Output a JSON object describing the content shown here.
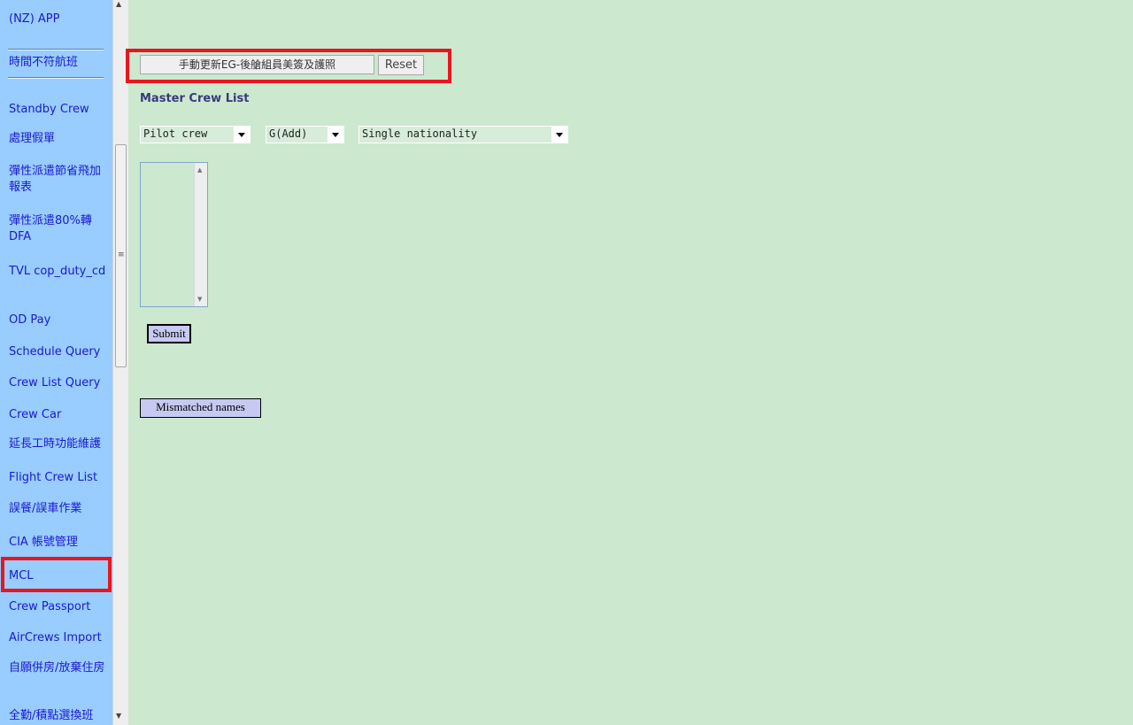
{
  "sidebar": {
    "items": [
      {
        "label": "(NZ) APP"
      },
      {
        "label": "時間不符航班"
      },
      {
        "label": "Standby Crew"
      },
      {
        "label": "處理假單"
      },
      {
        "label": "彈性派遣節省飛加報表"
      },
      {
        "label": "彈性派遣80%轉DFA"
      },
      {
        "label": "TVL cop_duty_cd"
      },
      {
        "label": "OD Pay"
      },
      {
        "label": "Schedule Query"
      },
      {
        "label": "Crew List Query"
      },
      {
        "label": "Crew Car"
      },
      {
        "label": "延長工時功能維護"
      },
      {
        "label": "Flight Crew List"
      },
      {
        "label": "誤餐/誤車作業"
      },
      {
        "label": "CIA 帳號管理"
      },
      {
        "label": "MCL"
      },
      {
        "label": "Crew Passport"
      },
      {
        "label": "AirCrews Import"
      },
      {
        "label": "自願併房/放棄住房"
      },
      {
        "label": "全勤/積點選換班"
      }
    ],
    "selected": "MCL"
  },
  "toolbar": {
    "update_label": "手動更新EG-後艙組員美簽及護照",
    "reset_label": "Reset"
  },
  "main": {
    "title": "Master Crew List",
    "crew_type": {
      "selected": "Pilot crew"
    },
    "action": {
      "selected": "G(Add)"
    },
    "nationality": {
      "selected": "Single nationality"
    },
    "submit_label": "Submit",
    "mismatch_label": "Mismatched names"
  },
  "colors": {
    "sidebar_bg": "#99ccff",
    "main_bg": "#cce8cf",
    "link": "#1a1acd",
    "highlight": "#e8161e",
    "button_blue": "#c6c9f2"
  }
}
